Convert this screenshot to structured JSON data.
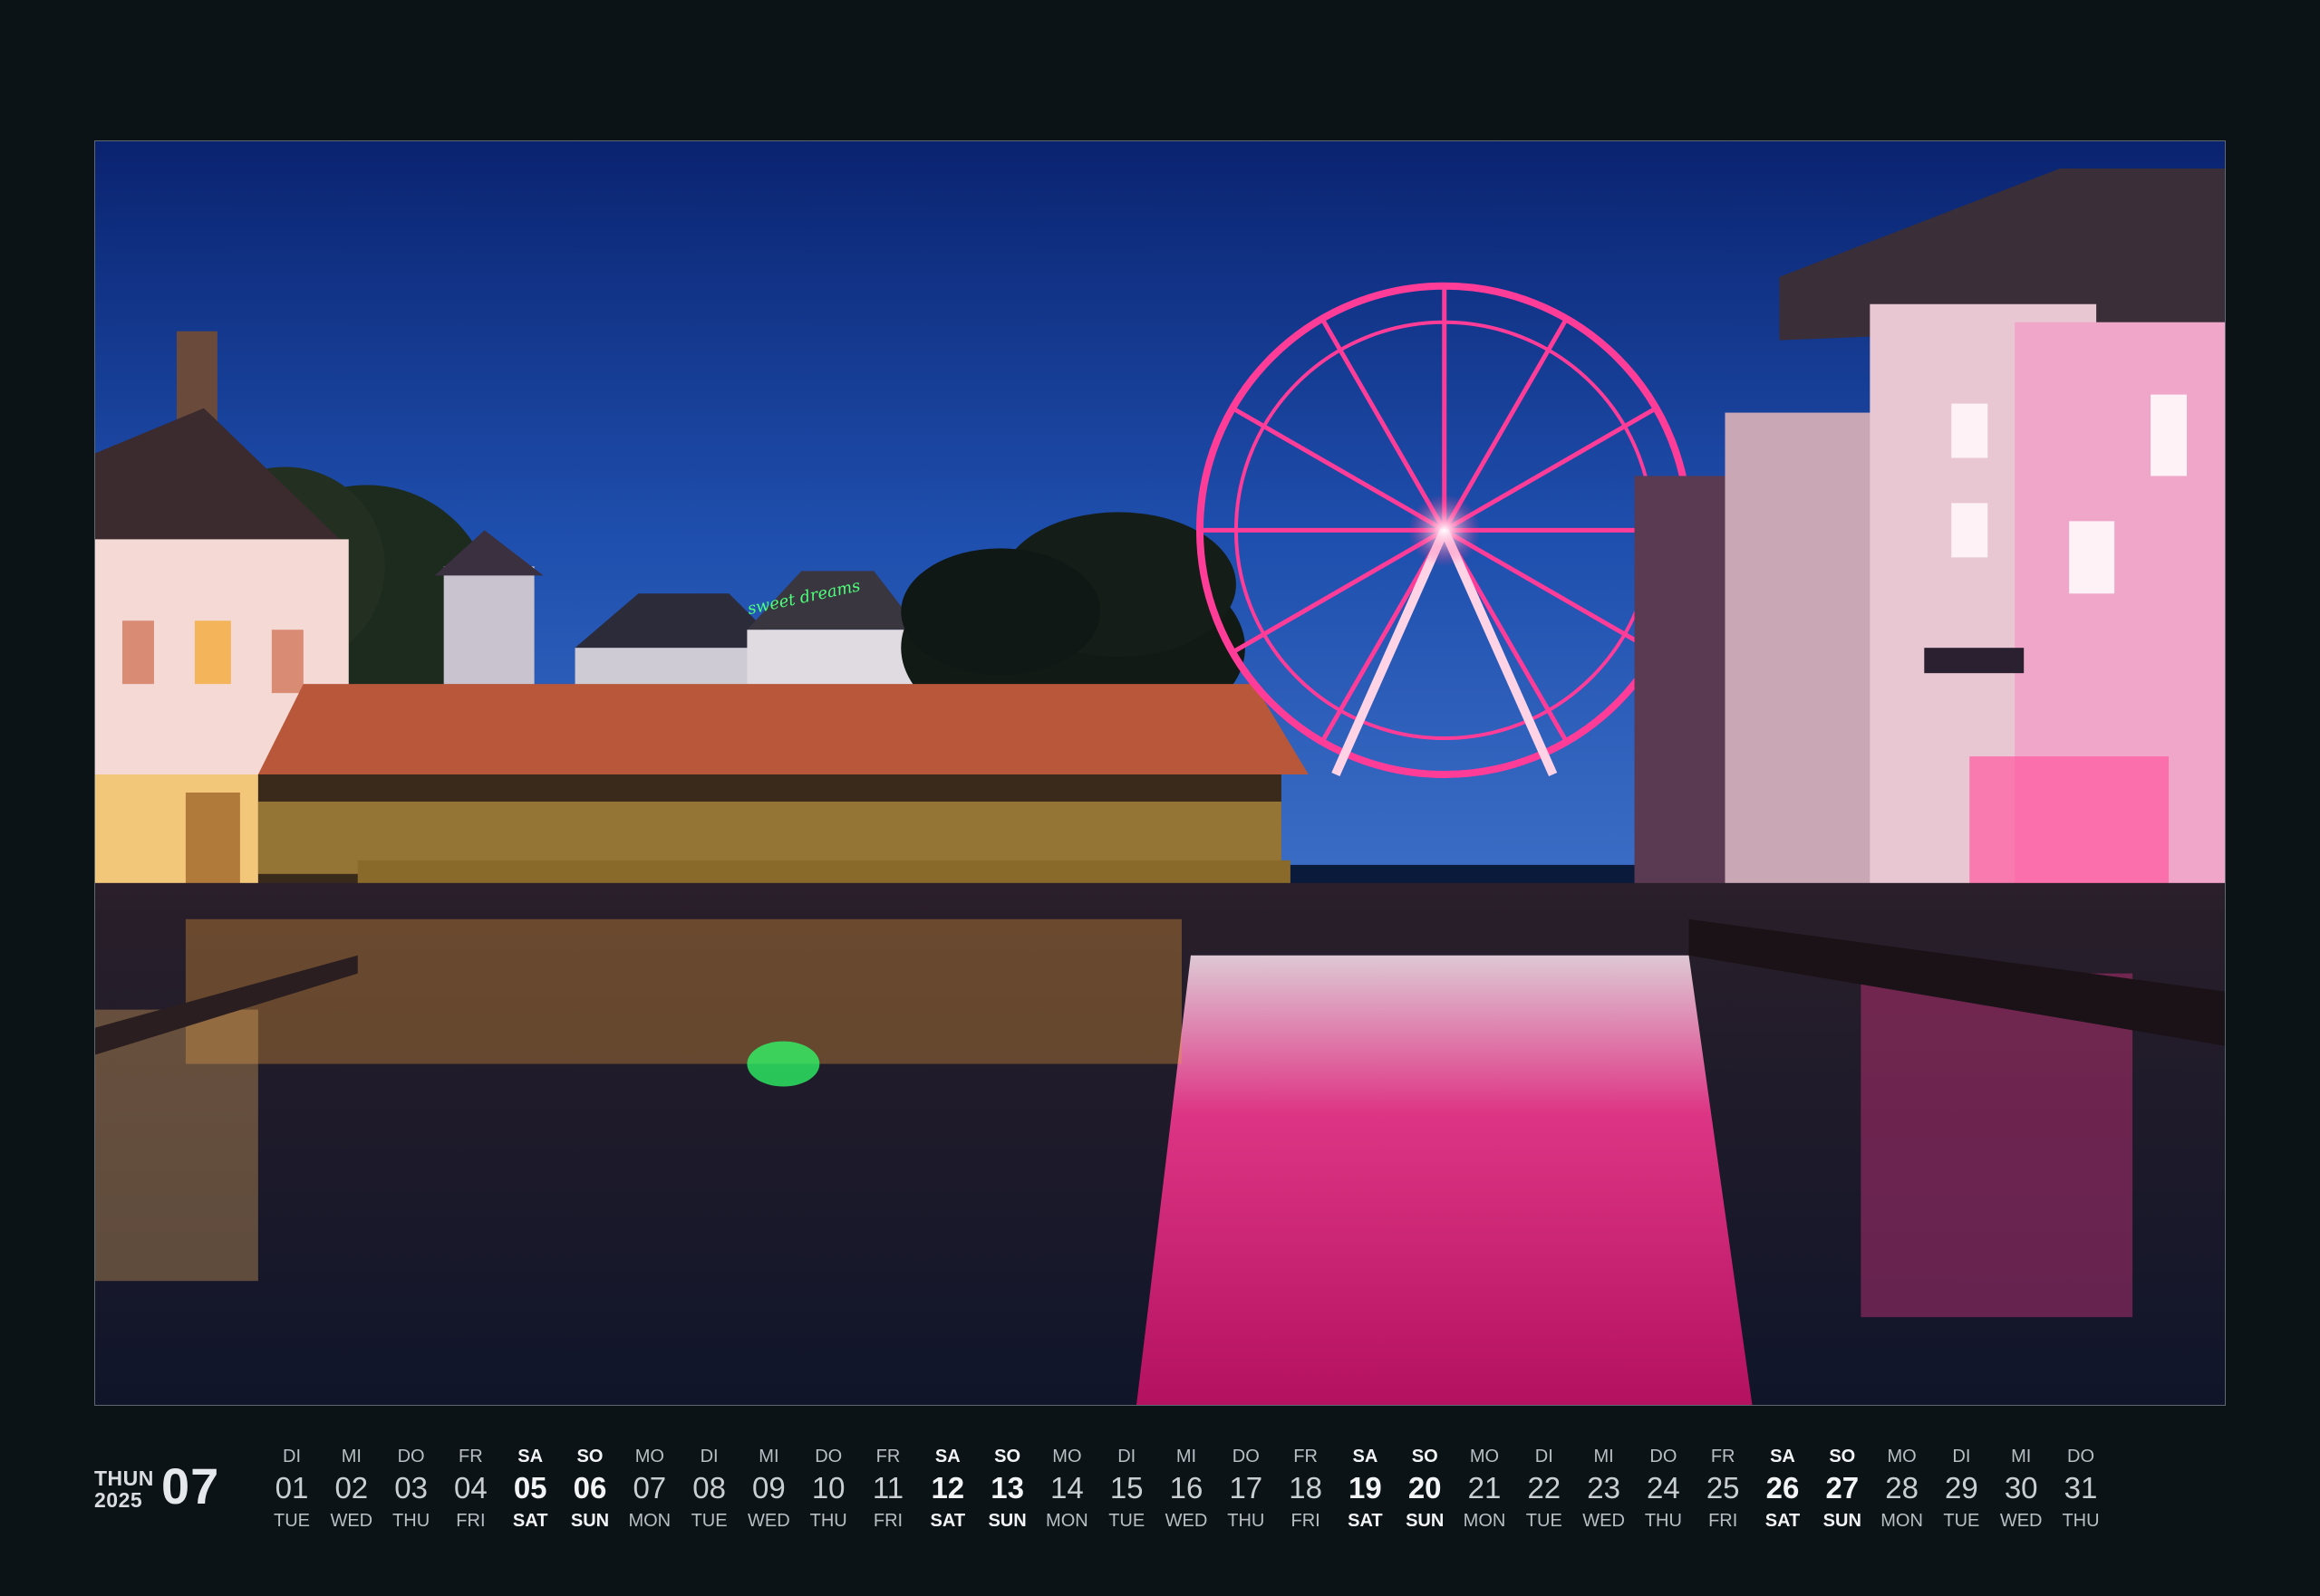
{
  "photo": {
    "neon_sign": "sweet dreams",
    "colors": {
      "sky_top": "#0b2a7a",
      "sky_bottom": "#2a5fbf",
      "wheel": "#ff2f8e",
      "water": "#141a2e"
    }
  },
  "calendar": {
    "city": "THUN",
    "year": "2025",
    "month": "07",
    "days": [
      {
        "de": "DI",
        "num": "01",
        "en": "TUE",
        "weekend": false
      },
      {
        "de": "MI",
        "num": "02",
        "en": "WED",
        "weekend": false
      },
      {
        "de": "DO",
        "num": "03",
        "en": "THU",
        "weekend": false
      },
      {
        "de": "FR",
        "num": "04",
        "en": "FRI",
        "weekend": false
      },
      {
        "de": "SA",
        "num": "05",
        "en": "SAT",
        "weekend": true
      },
      {
        "de": "SO",
        "num": "06",
        "en": "SUN",
        "weekend": true
      },
      {
        "de": "MO",
        "num": "07",
        "en": "MON",
        "weekend": false
      },
      {
        "de": "DI",
        "num": "08",
        "en": "TUE",
        "weekend": false
      },
      {
        "de": "MI",
        "num": "09",
        "en": "WED",
        "weekend": false
      },
      {
        "de": "DO",
        "num": "10",
        "en": "THU",
        "weekend": false
      },
      {
        "de": "FR",
        "num": "11",
        "en": "FRI",
        "weekend": false
      },
      {
        "de": "SA",
        "num": "12",
        "en": "SAT",
        "weekend": true
      },
      {
        "de": "SO",
        "num": "13",
        "en": "SUN",
        "weekend": true
      },
      {
        "de": "MO",
        "num": "14",
        "en": "MON",
        "weekend": false
      },
      {
        "de": "DI",
        "num": "15",
        "en": "TUE",
        "weekend": false
      },
      {
        "de": "MI",
        "num": "16",
        "en": "WED",
        "weekend": false
      },
      {
        "de": "DO",
        "num": "17",
        "en": "THU",
        "weekend": false
      },
      {
        "de": "FR",
        "num": "18",
        "en": "FRI",
        "weekend": false
      },
      {
        "de": "SA",
        "num": "19",
        "en": "SAT",
        "weekend": true
      },
      {
        "de": "SO",
        "num": "20",
        "en": "SUN",
        "weekend": true
      },
      {
        "de": "MO",
        "num": "21",
        "en": "MON",
        "weekend": false
      },
      {
        "de": "DI",
        "num": "22",
        "en": "TUE",
        "weekend": false
      },
      {
        "de": "MI",
        "num": "23",
        "en": "WED",
        "weekend": false
      },
      {
        "de": "DO",
        "num": "24",
        "en": "THU",
        "weekend": false
      },
      {
        "de": "FR",
        "num": "25",
        "en": "FRI",
        "weekend": false
      },
      {
        "de": "SA",
        "num": "26",
        "en": "SAT",
        "weekend": true
      },
      {
        "de": "SO",
        "num": "27",
        "en": "SUN",
        "weekend": true
      },
      {
        "de": "MO",
        "num": "28",
        "en": "MON",
        "weekend": false
      },
      {
        "de": "DI",
        "num": "29",
        "en": "TUE",
        "weekend": false
      },
      {
        "de": "MI",
        "num": "30",
        "en": "WED",
        "weekend": false
      },
      {
        "de": "DO",
        "num": "31",
        "en": "THU",
        "weekend": false
      }
    ]
  }
}
